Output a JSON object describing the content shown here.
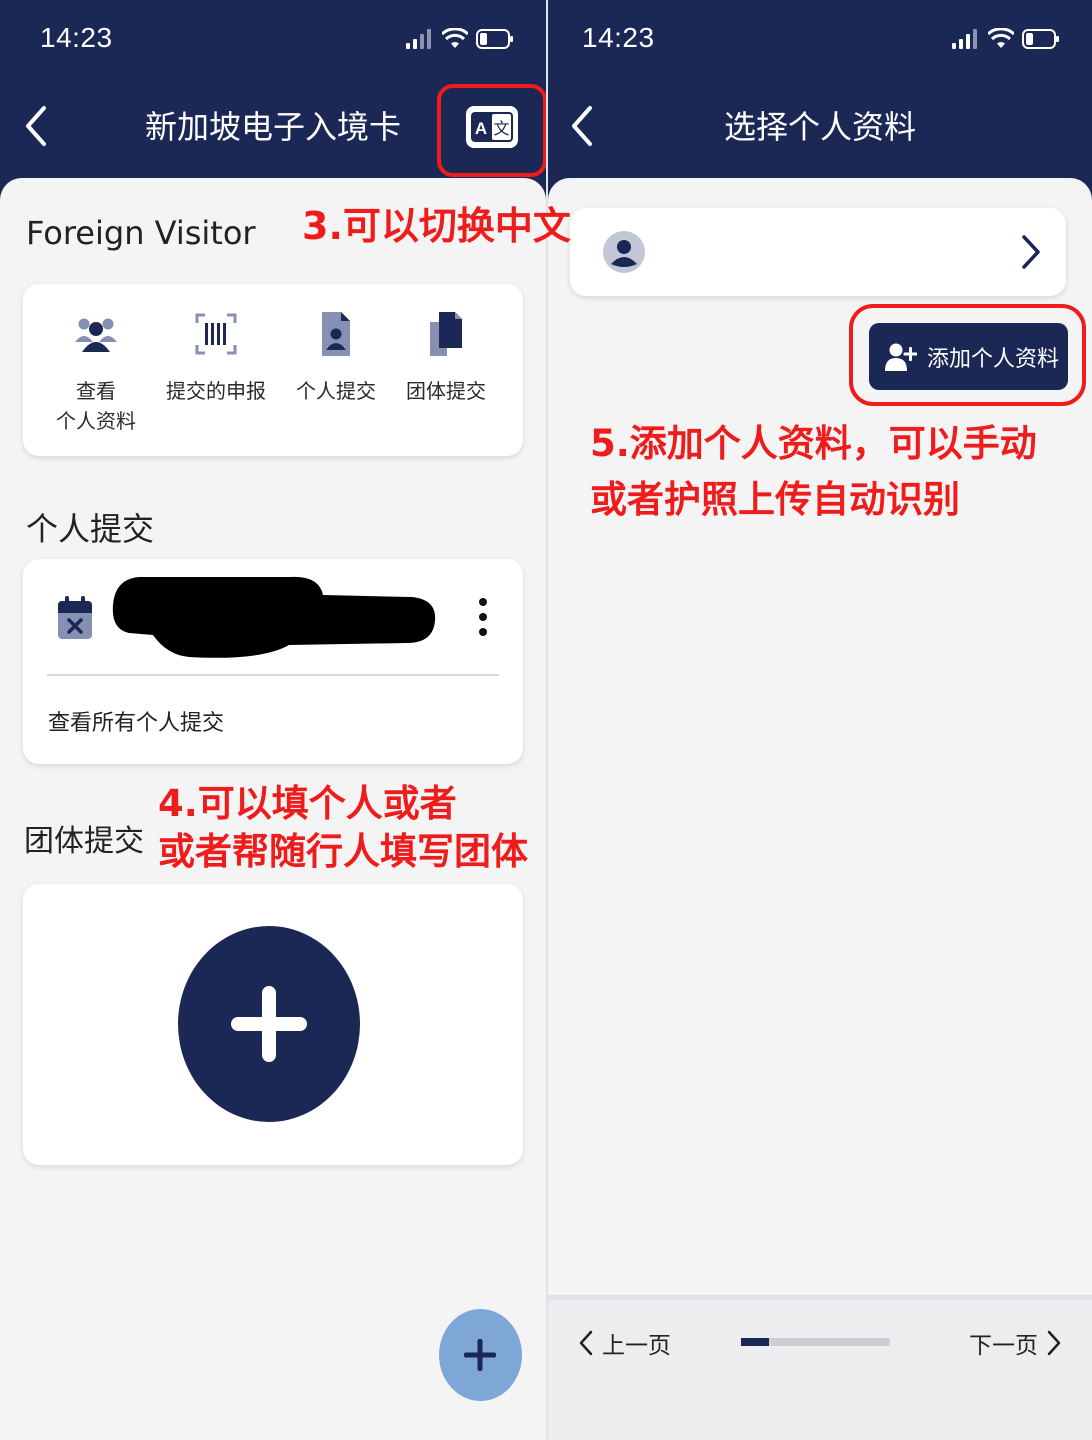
{
  "status_bar": {
    "time": "14:23"
  },
  "left": {
    "header": {
      "title": "新加坡电子入境卡"
    },
    "visitor_type": "Foreign Visitor",
    "quick_actions": [
      {
        "label": "查看\n个人资料",
        "icon": "users-icon"
      },
      {
        "label": "提交的申报",
        "icon": "barcode-icon"
      },
      {
        "label": "个人提交",
        "icon": "person-document-icon"
      },
      {
        "label": "团体提交",
        "icon": "documents-icon"
      }
    ],
    "individual_section": {
      "title": "个人提交",
      "link": "查看所有个人提交"
    },
    "group_section": {
      "title": "团体提交"
    }
  },
  "right": {
    "header": {
      "title": "选择个人资料"
    },
    "add_profile_button": "添加个人资料",
    "footer": {
      "prev": "上一页",
      "next": "下一页",
      "progress": 0.19
    }
  },
  "annotations": {
    "a3": "3.可以切换中文",
    "a4_line1": "4.可以填个人或者",
    "a4_line2": "或者帮随行人填写团体",
    "a5_line1": "5.添加个人资料，可以手动",
    "a5_line2": "或者护照上传自动识别"
  },
  "colors": {
    "navy": "#1b2755",
    "annotation_red": "#ef1c1c",
    "fab_light": "#7ea7d8"
  }
}
